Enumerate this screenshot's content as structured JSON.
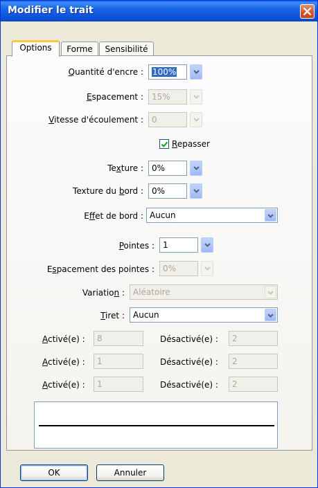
{
  "window": {
    "title": "Modifier le trait",
    "close_icon": "close-icon"
  },
  "tabs": [
    {
      "label": "Options",
      "active": true
    },
    {
      "label": "Forme",
      "active": false
    },
    {
      "label": "Sensibilité",
      "active": false
    }
  ],
  "ink_quantity": {
    "label_pre": "",
    "label_ul": "Q",
    "label_post": "uantité d'encre :",
    "value": "100%"
  },
  "spacing": {
    "label_pre": "",
    "label_ul": "E",
    "label_post": "spacement :",
    "value": "15%"
  },
  "flow_speed": {
    "label_pre": "",
    "label_ul": "V",
    "label_post": "itesse d'écoulement :",
    "value": "0"
  },
  "retrace": {
    "label_pre": "",
    "label_ul": "R",
    "label_post": "epasser",
    "checked": true
  },
  "texture": {
    "label_pre": "Te",
    "label_ul": "x",
    "label_post": "ture :",
    "value": "0%"
  },
  "edge_texture": {
    "label_pre": "Texture du ",
    "label_ul": "b",
    "label_post": "ord :",
    "value": "0%"
  },
  "edge_effect": {
    "label_pre": "E",
    "label_ul": "f",
    "label_post": "fet de bord :",
    "value": "Aucun"
  },
  "tips": {
    "label_pre": "",
    "label_ul": "P",
    "label_post": "ointes :",
    "value": "1"
  },
  "tip_spacing": {
    "label_pre": "E",
    "label_ul": "s",
    "label_post": "pacement des pointes :",
    "value": "0%"
  },
  "variation": {
    "label_pre": "Variatio",
    "label_ul": "n",
    "label_post": " :",
    "value": "Aléatoire"
  },
  "dash": {
    "label_pre": "",
    "label_ul": "T",
    "label_post": "iret :",
    "value": "Aucun"
  },
  "dash_rows": [
    {
      "on_label_ul": "A",
      "on_label_post": "ctivé(e) :",
      "on_value": "8",
      "off_label": "Désactivé(e) :",
      "off_value": "2"
    },
    {
      "on_label_ul": "A",
      "on_label_post": "ctivé(e) :",
      "on_value": "1",
      "off_label": "Désactivé(e) :",
      "off_value": "2"
    },
    {
      "on_label_ul": "A",
      "on_label_post": "ctivé(e) :",
      "on_value": "1",
      "off_label": "Désactivé(e) :",
      "off_value": "2"
    }
  ],
  "buttons": {
    "ok": "OK",
    "cancel": "Annuler"
  },
  "colors": {
    "titlebar": "#0b4fd8",
    "dialog_bg": "#ece9d8",
    "close_button": "#d35a2c",
    "active_tab_accent": "#ffc83c",
    "selection": "#316ac5"
  }
}
